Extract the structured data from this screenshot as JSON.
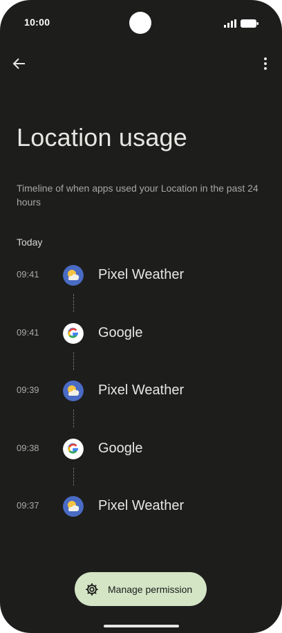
{
  "status_bar": {
    "time": "10:00"
  },
  "page": {
    "title": "Location usage",
    "subtitle": "Timeline of when apps used your Location in the past 24 hours",
    "section": "Today"
  },
  "timeline": [
    {
      "time": "09:41",
      "app": "Pixel Weather",
      "icon": "weather-icon"
    },
    {
      "time": "09:41",
      "app": "Google",
      "icon": "google-icon"
    },
    {
      "time": "09:39",
      "app": "Pixel Weather",
      "icon": "weather-icon"
    },
    {
      "time": "09:38",
      "app": "Google",
      "icon": "google-icon"
    },
    {
      "time": "09:37",
      "app": "Pixel Weather",
      "icon": "weather-icon"
    }
  ],
  "fab": {
    "label": "Manage permission"
  },
  "colors": {
    "background": "#1d1e1c",
    "fab": "#d4e5c6"
  }
}
